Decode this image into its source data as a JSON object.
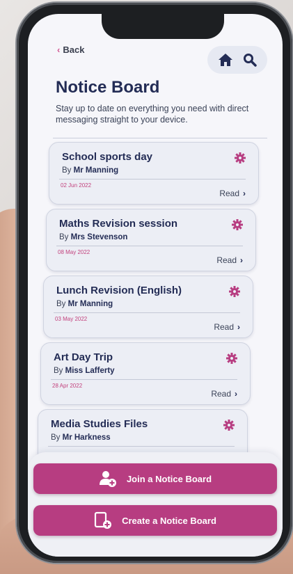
{
  "header": {
    "back_label": "Back",
    "home_icon": "home-icon",
    "search_icon": "search-icon"
  },
  "page": {
    "title": "Notice Board",
    "subtitle": "Stay up to date on everything you need with direct messaging straight to your device."
  },
  "notices": [
    {
      "title": "School sports day",
      "by": "By",
      "author": "Mr Manning",
      "date": "02 Jun 2022",
      "action": "Read"
    },
    {
      "title": "Maths Revision session",
      "by": "By",
      "author": "Mrs Stevenson",
      "date": "08 May 2022",
      "action": "Read"
    },
    {
      "title": "Lunch Revision (English)",
      "by": "By",
      "author": "Mr Manning",
      "date": "03 May 2022",
      "action": "Read"
    },
    {
      "title": "Art Day Trip",
      "by": "By",
      "author": "Miss Lafferty",
      "date": "28 Apr 2022",
      "action": "Read"
    },
    {
      "title": "Media Studies Files",
      "by": "By",
      "author": "Mr Harkness",
      "date": "",
      "action": ""
    }
  ],
  "actions": {
    "join_label": "Join a Notice Board",
    "create_label": "Create a Notice Board"
  },
  "colors": {
    "accent": "#b73d81",
    "title_navy": "#232c55",
    "date_pink": "#c2407c",
    "background": "#f6f6fa"
  }
}
